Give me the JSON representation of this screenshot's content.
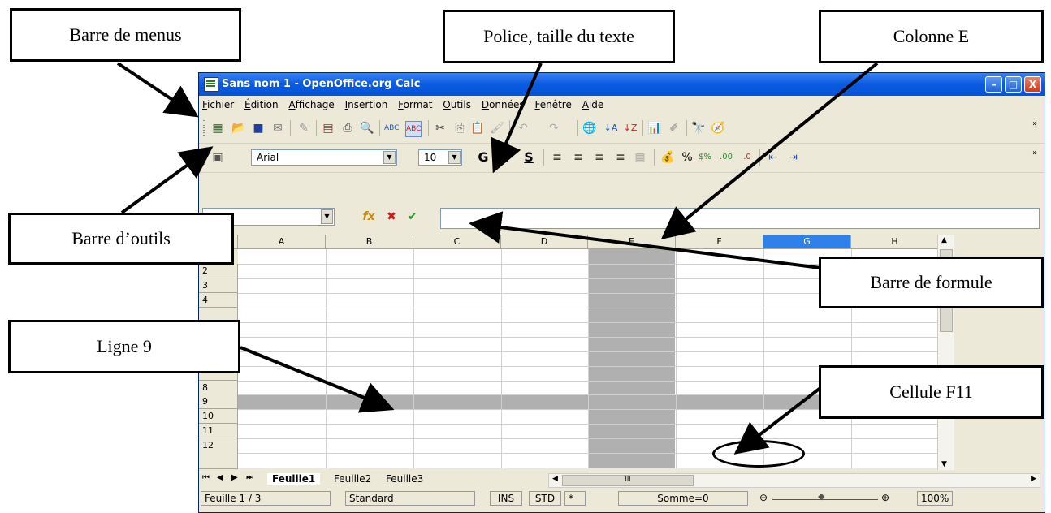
{
  "window": {
    "title": "Sans nom 1 - OpenOffice.org Calc",
    "buttons": [
      "–",
      "□",
      "X"
    ]
  },
  "menu": [
    "Fichier",
    "Édition",
    "Affichage",
    "Insertion",
    "Format",
    "Outils",
    "Données",
    "Fenêtre",
    "Aide"
  ],
  "toolbar_formatting": {
    "font": "Arial",
    "size": "10",
    "bold": "G",
    "italic": "I",
    "underline": "S",
    "percent": "%"
  },
  "columns": [
    "A",
    "B",
    "C",
    "D",
    "E",
    "F",
    "G",
    "H"
  ],
  "rows": [
    "2",
    "3",
    "4",
    "8",
    "9",
    "10",
    "11",
    "12"
  ],
  "sheet_tabs": [
    "Feuille1",
    "Feuille2",
    "Feuille3"
  ],
  "hscroll_label": "III",
  "status": {
    "sheet": "Feuille 1 / 3",
    "style": "Standard",
    "ins": "INS",
    "std": "STD",
    "star": "*",
    "sum": "Somme=0",
    "zoom": "100%"
  },
  "callouts": {
    "menus": "Barre de menus",
    "police": "Police, taille du texte",
    "colonne": "Colonne E",
    "outils": "Barre d’outils",
    "formule": "Barre de formule",
    "ligne": "Ligne 9",
    "cellule": "Cellule F11"
  },
  "colors": {
    "highlight": "#b0b0b0",
    "selected_col": "#2f80e8",
    "titlebar": "#0a5ae0"
  }
}
